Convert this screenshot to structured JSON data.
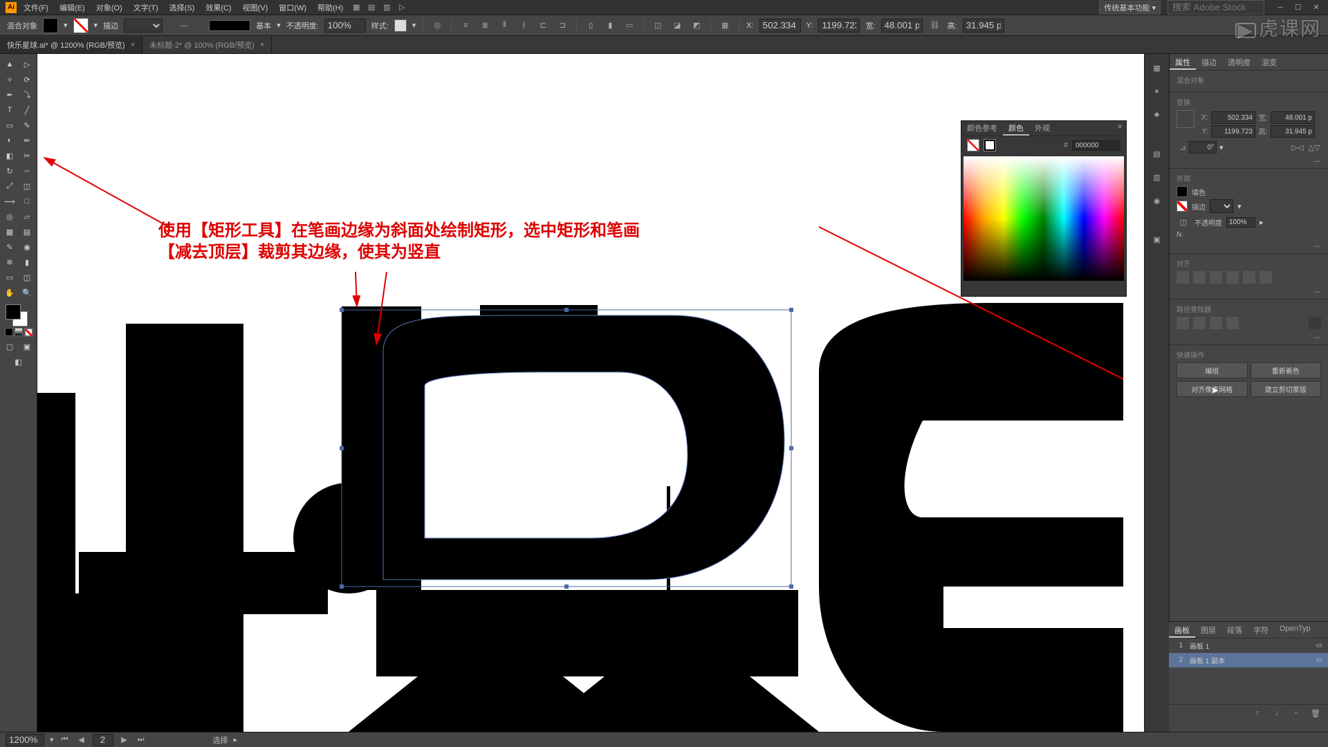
{
  "menu": {
    "file": "文件(F)",
    "edit": "编辑(E)",
    "object": "对象(O)",
    "type": "文字(T)",
    "select": "选择(S)",
    "effect": "效果(C)",
    "view": "视图(V)",
    "window": "窗口(W)",
    "help": "帮助(H)"
  },
  "workspace": "传统基本功能",
  "search_placeholder": "搜索 Adobe Stock",
  "control": {
    "label": "混合对象",
    "stroke_label": "描边",
    "brush_label": "基本",
    "opacity_label": "不透明度:",
    "opacity_value": "100%",
    "style_label": "样式:",
    "x_label": "X:",
    "x_val": "502.334",
    "y_label": "Y:",
    "y_val": "1199.723",
    "w_label": "宽:",
    "w_val": "48.001 p",
    "h_label": "高:",
    "h_val": "31.945 p"
  },
  "tabs": [
    {
      "title": "快乐星球.ai* @ 1200% (RGB/预览)"
    },
    {
      "title": "未标题-2* @ 100% (RGB/预览)"
    }
  ],
  "annotation": {
    "line1": "使用【矩形工具】在笔画边缘为斜面处绘制矩形，选中矩形和笔画",
    "line2": "【减去顶层】裁剪其边缘，使其为竖直"
  },
  "prop_tabs": {
    "props": "属性",
    "stroke": "描边",
    "opacity": "透明度",
    "blend": "混变"
  },
  "prop": {
    "header": "混合对象",
    "transform": "变换",
    "x": "502.334",
    "y": "1199.723",
    "w": "48.001 p",
    "h": "31.945 p",
    "angle": "0°"
  },
  "appearance": {
    "title": "外观",
    "fill": "填色",
    "stroke": "描边",
    "opacity": "不透明度",
    "opacity_val": "100%",
    "fx": "fx."
  },
  "align": {
    "title": "对齐"
  },
  "pathfinder": {
    "title": "路径查找器"
  },
  "quick": {
    "title": "快速操作",
    "b1": "编组",
    "b2": "重新着色",
    "b3": "对齐像素网格",
    "b4": "建立剪切蒙版"
  },
  "color_popup": {
    "t1": "颜色参考",
    "t2": "颜色",
    "t3": "外观",
    "hex": "000000"
  },
  "artboard": {
    "tabs": {
      "t1": "画板",
      "t2": "图层",
      "t3": "段落",
      "t4": "字符",
      "t5": "OpenTyp"
    },
    "rows": [
      {
        "n": "1",
        "name": "画板 1"
      },
      {
        "n": "2",
        "name": "画板 1 副本"
      }
    ]
  },
  "status": {
    "zoom": "1200%",
    "ab": "2",
    "tool": "选择"
  },
  "watermark": "虎课网"
}
